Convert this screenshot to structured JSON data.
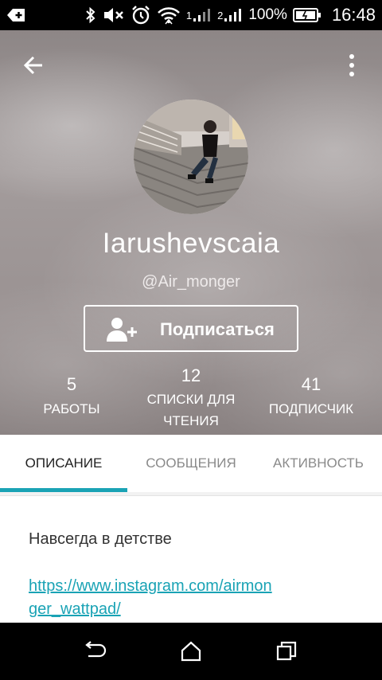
{
  "status_bar": {
    "battery_percent": "100%",
    "time": "16:48",
    "signal_1_label": "1",
    "signal_2_label": "2",
    "icons": [
      "notification-plus-icon",
      "bluetooth-icon",
      "mute-icon",
      "alarm-icon",
      "wifi-icon",
      "signal-icon",
      "battery-icon"
    ]
  },
  "profile": {
    "display_name": "Iarushevscaia",
    "handle": "@Air_monger",
    "follow_label": "Подписаться"
  },
  "stats": {
    "works": {
      "value": "5",
      "label": "РАБОТЫ"
    },
    "reading_lists": {
      "value": "12",
      "label_line1": "СПИСКИ ДЛЯ",
      "label_line2": "ЧТЕНИЯ"
    },
    "followers": {
      "value": "41",
      "label": "ПОДПИСЧИК"
    }
  },
  "tabs": [
    {
      "label": "ОПИСАНИЕ",
      "active": true
    },
    {
      "label": "СООБЩЕНИЯ",
      "active": false
    },
    {
      "label": "АКТИВНОСТЬ",
      "active": false
    }
  ],
  "about": {
    "bio": "Навсегда в детстве",
    "link": "https://www.instagram.com/airmonger_wattpad/"
  },
  "colors": {
    "accent": "#1aa3b5",
    "header_bg": "#9a9292",
    "statusbar_bg": "#000000"
  }
}
